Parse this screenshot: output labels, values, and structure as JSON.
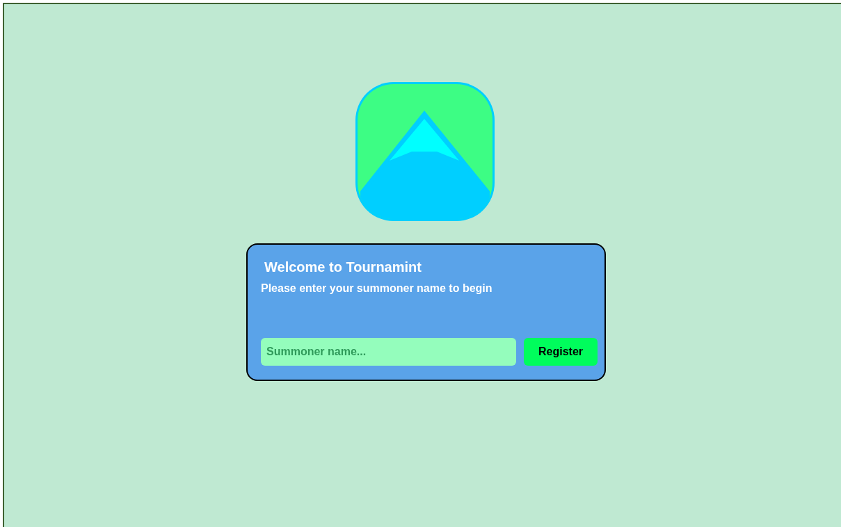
{
  "login_card": {
    "title": "Welcome to Tournamint",
    "subtitle": "Please enter your summoner name to begin",
    "name_field": {
      "placeholder": "Summoner name..."
    },
    "register_button": "Register"
  }
}
